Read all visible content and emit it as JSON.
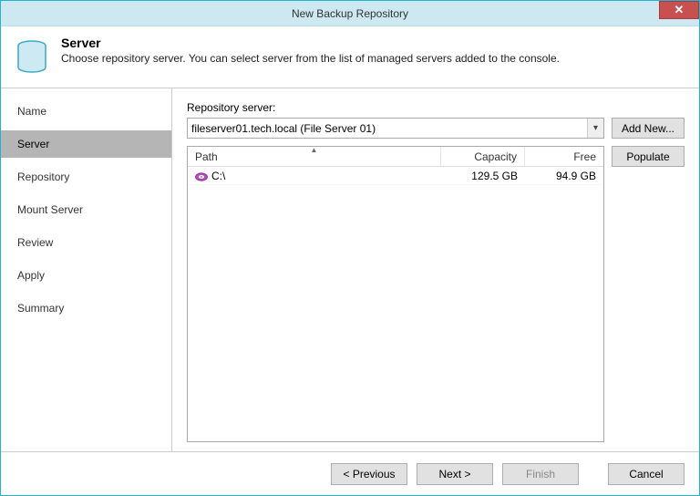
{
  "window": {
    "title": "New Backup Repository"
  },
  "header": {
    "title": "Server",
    "subtitle": "Choose repository server. You can select server from the list of managed servers added to the console."
  },
  "nav": {
    "items": [
      {
        "label": "Name"
      },
      {
        "label": "Server"
      },
      {
        "label": "Repository"
      },
      {
        "label": "Mount Server"
      },
      {
        "label": "Review"
      },
      {
        "label": "Apply"
      },
      {
        "label": "Summary"
      }
    ],
    "active_index": 1
  },
  "content": {
    "repo_server_label": "Repository server:",
    "repo_server_value": "fileserver01.tech.local (File Server 01)",
    "buttons": {
      "add_new": "Add New...",
      "populate": "Populate"
    },
    "columns": {
      "path": "Path",
      "capacity": "Capacity",
      "free": "Free"
    },
    "rows": [
      {
        "path": "C:\\",
        "capacity": "129.5 GB",
        "free": "94.9 GB"
      }
    ]
  },
  "footer": {
    "previous": "< Previous",
    "next": "Next >",
    "finish": "Finish",
    "cancel": "Cancel"
  }
}
